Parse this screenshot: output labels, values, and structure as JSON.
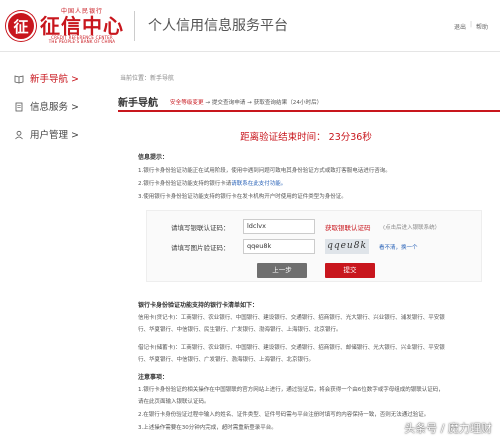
{
  "header": {
    "logo_top": "中国人民银行",
    "logo_main": "征信中心",
    "logo_en1": "CREDIT REFERENCE CENTER",
    "logo_en2": "THE PEOPLE'S BANK OF CHINA",
    "logo_seal": "征",
    "platform_title": "个人信用信息服务平台",
    "exit": "退出",
    "help": "帮助"
  },
  "sidebar": {
    "items": [
      {
        "label": "新手导航 >",
        "icon": "book-icon"
      },
      {
        "label": "信息服务 >",
        "icon": "document-icon"
      },
      {
        "label": "用户管理 >",
        "icon": "user-icon"
      }
    ]
  },
  "main": {
    "breadcrumb": "当前位置：新手导航",
    "tab_title": "新手导航",
    "steps": {
      "current": "安全等级变更",
      "rest": " → 提交查询申请 → 获取查询结果（24小时后）"
    },
    "countdown": "距离验证结束时间： 23分36秒",
    "tips_title": "信息提示：",
    "tips": [
      "1.银行卡身份验证功能正在试用阶段，使用中遇到问题可致电其身份验证方式或致打客服电话进行咨询。",
      "2.银行卡身份验证功能支持的银行卡请",
      "3.使用银行卡身份验证功能支持的银行卡在发卡机构开户时使用的证件类型为身份证。"
    ],
    "tip2_link": "请联系在此支付功能。",
    "form": {
      "code_label": "请填写银联认证码：",
      "code_value": "ldclvx",
      "get_code": "获取银联认证码",
      "hint_prefix": "(点击后进入银联系统）",
      "captcha_label": "请填写图片验证码：",
      "captcha_value": "qqeu8k",
      "captcha_image_text": "qqeu8k",
      "hint_captcha": "看不清，换一个",
      "prev": "上一步",
      "submit": "提交"
    },
    "banks_title": "银行卡身份验证功能支持的银行卡清单如下：",
    "banks": [
      "信用卡(贷记卡)：工商银行、农业银行、中国银行、建设银行、交通银行、招商银行、光大银行、兴业银行、浦发银行、平安银",
      "    行、华夏银行、中信银行、民生银行、广发银行、渤海银行、上海银行、北京银行。",
      "借记卡(储蓄卡)：工商银行、农业银行、中国银行、建设银行、交通银行、招商银行、邮储银行、光大银行、兴业银行、平安银",
      "    行、华夏银行、中信银行、广发银行、渤海银行、上海银行、北京银行。"
    ],
    "notes_title": "注意事项：",
    "notes": [
      "1.银行卡身份验证的相关操作在中国银联的官方网站上进行，通过验证后，将会获得一个由6位数字或字母组成的银联认证码，",
      "  请在此页面输入银联认证码。",
      "2.在银行卡身份验证过程中输入的姓名、证件类型、证件号码需与平台注册时填写的内容保持一致，否则无法通过验证。",
      "3.上述操作需要在30分钟内完成，超时需重新登录平台。"
    ]
  },
  "watermark": "头条号 / 魔力理财"
}
